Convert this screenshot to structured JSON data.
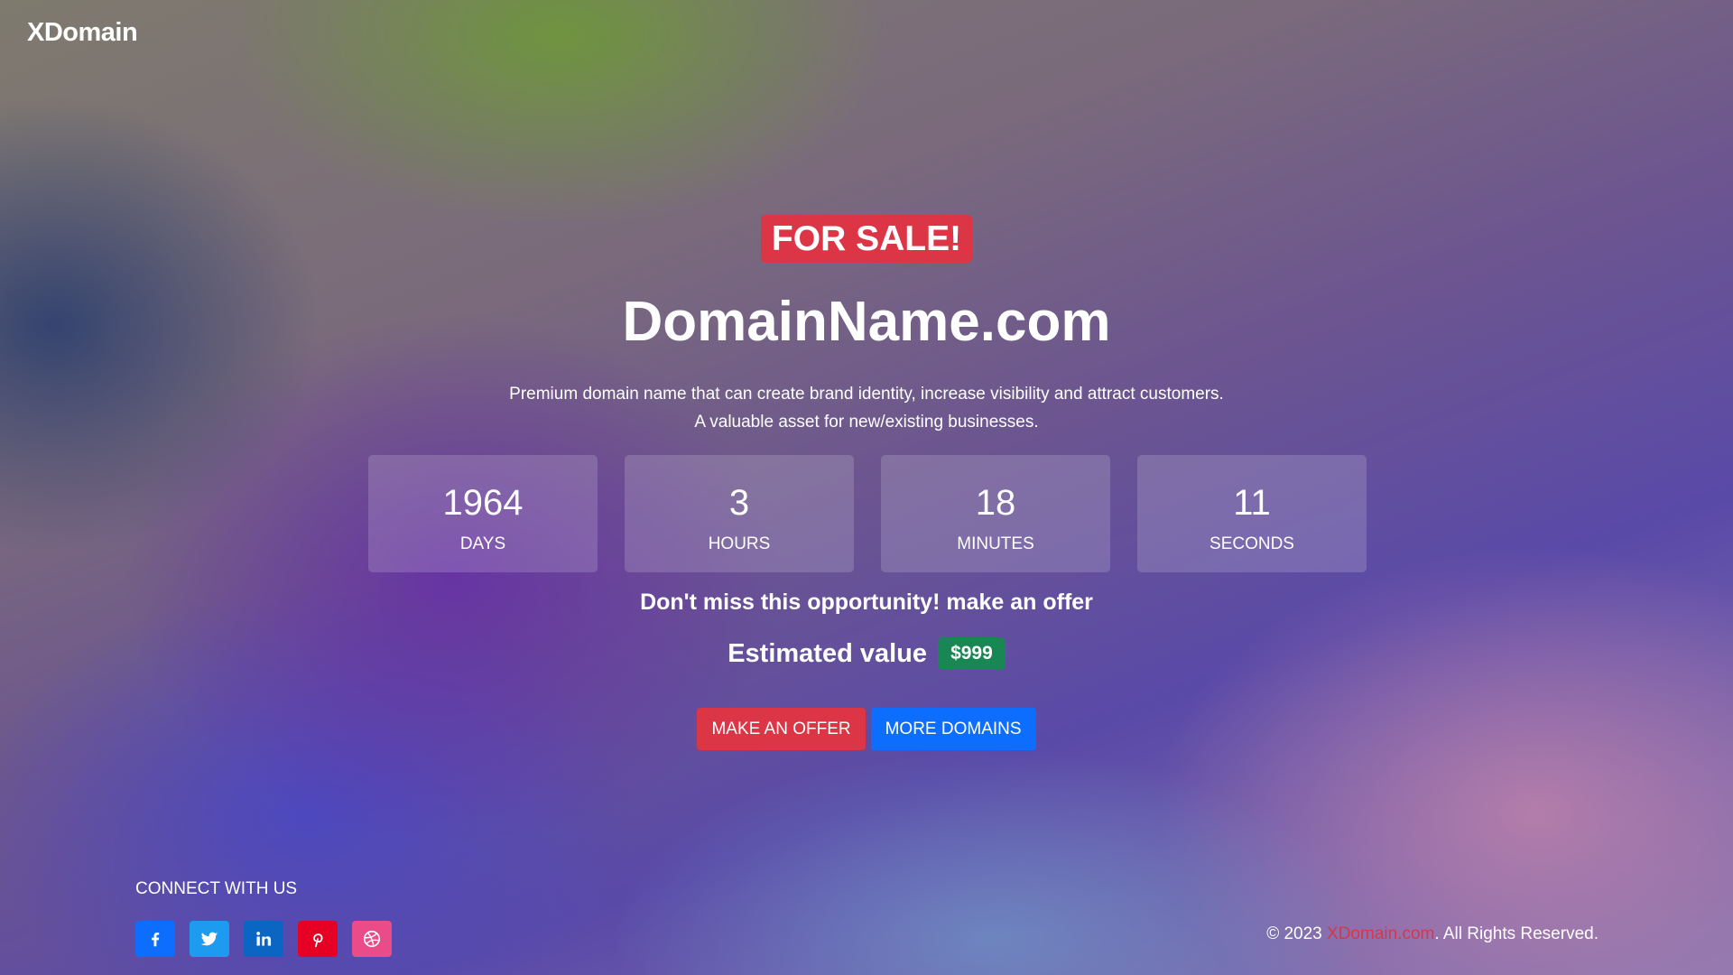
{
  "brand": {
    "logo": "XDomain"
  },
  "hero": {
    "badge": "FOR SALE!",
    "domain": "DomainName.com",
    "description_line1": "Premium domain name that can create brand identity, increase visibility and attract customers.",
    "description_line2": "A valuable asset for new/existing businesses."
  },
  "countdown": [
    {
      "value": "1964",
      "label": "DAYS"
    },
    {
      "value": "3",
      "label": "HOURS"
    },
    {
      "value": "18",
      "label": "MINUTES"
    },
    {
      "value": "11",
      "label": "SECONDS"
    }
  ],
  "offer": {
    "cta_text": "Don't miss this opportunity! make an offer",
    "estimated_label": "Estimated value",
    "estimated_price": "$999"
  },
  "actions": {
    "make_offer": "MAKE AN OFFER",
    "more_domains": "MORE DOMAINS"
  },
  "footer": {
    "connect_title": "CONNECT WITH US",
    "socials": [
      {
        "icon": "facebook-icon",
        "color": "#0d6efd"
      },
      {
        "icon": "twitter-icon",
        "color": "#1d9bf0"
      },
      {
        "icon": "linkedin-icon",
        "color": "#0a66c2"
      },
      {
        "icon": "pinterest-icon",
        "color": "#e60023"
      },
      {
        "icon": "dribbble-icon",
        "color": "#ea4c89"
      }
    ],
    "copyright_prefix": "© 2023",
    "copyright_link": "XDomain.com",
    "copyright_suffix": ". All Rights Reserved."
  },
  "colors": {
    "danger": "#dc3545",
    "primary": "#0d6efd",
    "success": "#198754"
  }
}
